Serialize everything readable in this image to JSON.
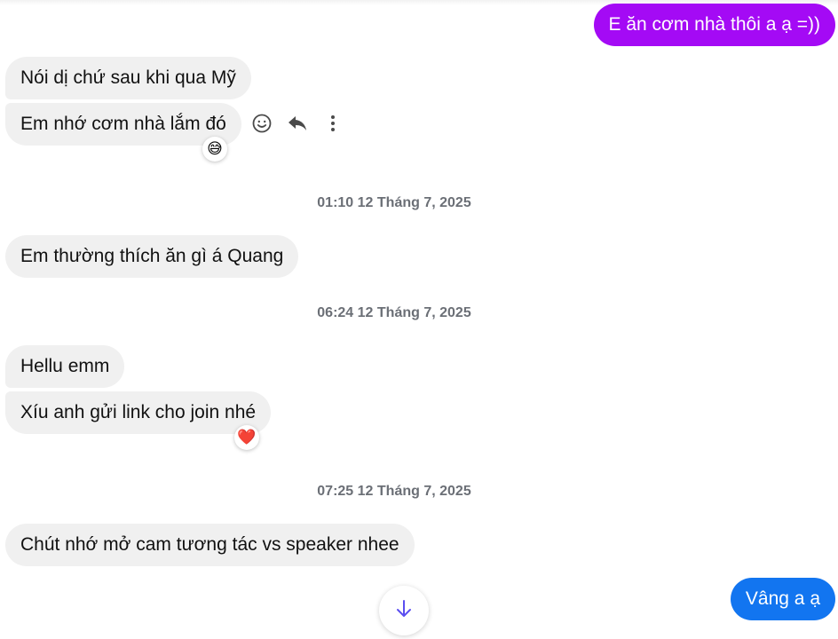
{
  "messages": [
    {
      "direction": "outgoing",
      "text": "E ăn cơm nhà thôi a ạ =))"
    },
    {
      "direction": "incoming",
      "text": "Nói dị chứ sau khi qua Mỹ"
    },
    {
      "direction": "incoming",
      "text": "Em nhớ cơm nhà lắm đó",
      "reaction": "😅"
    },
    {
      "type": "timestamp",
      "text": "01:10 12 Tháng 7, 2025"
    },
    {
      "direction": "incoming",
      "text": "Em thường thích ăn gì á Quang"
    },
    {
      "type": "timestamp",
      "text": "06:24 12 Tháng 7, 2025"
    },
    {
      "direction": "incoming",
      "text": "Hellu emm"
    },
    {
      "direction": "incoming",
      "text": "Xíu anh gửi link cho join nhé",
      "reaction": "❤️"
    },
    {
      "type": "timestamp",
      "text": "07:25 12 Tháng 7, 2025"
    },
    {
      "direction": "incoming",
      "text": "Chút nhớ mở cam tương tác vs speaker nhee"
    },
    {
      "direction": "outgoing",
      "text": "Vâng a ạ"
    }
  ],
  "hover_actions": [
    "react-icon",
    "reply-icon",
    "more-options-icon"
  ],
  "scroll_button": {
    "icon": "arrow-down-icon"
  },
  "colors": {
    "outgoing_purple": "#a40af5",
    "outgoing_blue": "#1275f0",
    "incoming_bubble": "#f0f0f0",
    "timestamp_text": "#6b6f76",
    "scroll_arrow": "#5b4ef0"
  }
}
